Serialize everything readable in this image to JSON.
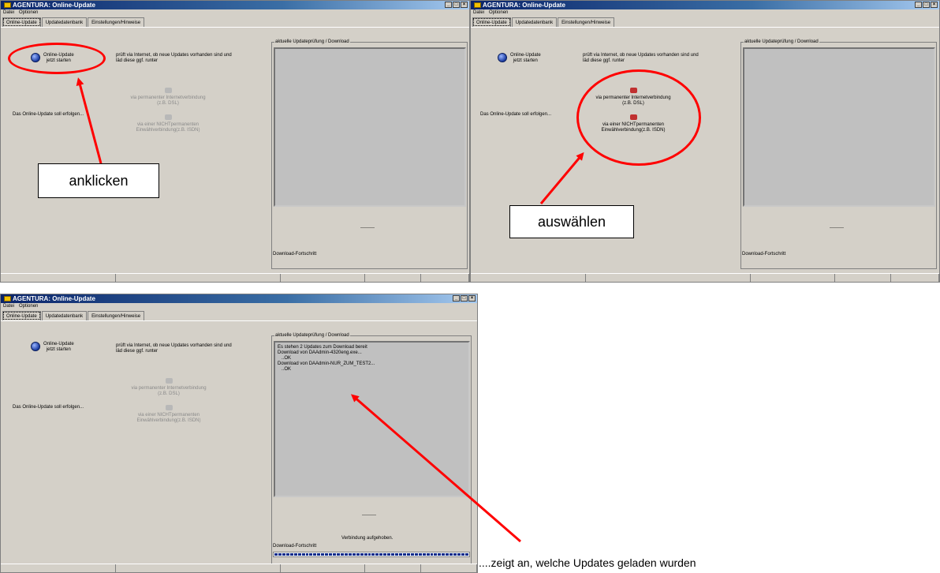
{
  "window": {
    "title": "AGENTURA: Online-Update",
    "menu": [
      "Datei",
      "Optionen"
    ],
    "tabs": [
      "Online-Update",
      "Updatedatenbank",
      "Einstellungen/Hinweise"
    ]
  },
  "left": {
    "online_update_line1": "Online-Update",
    "online_update_line2": "jetzt starten",
    "description_line1": "prüft via Internet, ob neue Updates vorhanden sind und",
    "description_line2": "läd diese ggf. runter",
    "soll_text": "Das Online-Update soll erfolgen...",
    "option1_line1": "via permanenter Internetverbindung",
    "option1_line2": "(z.B. DSL)",
    "option2_line1": "via einer NICHTpermanenten",
    "option2_line2": "Einwählverbindung(z.B. ISDN)"
  },
  "right": {
    "group_title": "aktuelle Updateprüfung / Download",
    "dashes": "---------",
    "download_label": "Download-Fortschritt",
    "connection_closed": "Verbindung aufgehoben.",
    "log": "Es stehen 2 Updates zum Download bereit\nDownload von DAAdmin-4320eng.exe...\n   ..OK\nDownload von DAAdmin-NUR_ZUM_TEST2...\n   ..OK"
  },
  "annotations": {
    "callout1": "anklicken",
    "callout2": "auswählen",
    "caption3": "....zeigt an, welche Updates geladen wurden"
  },
  "colors": {
    "highlight": "#ff0000",
    "titlebar": "#0a246a",
    "progress": "#0a2a8a"
  },
  "progress_fraction": 1.0
}
